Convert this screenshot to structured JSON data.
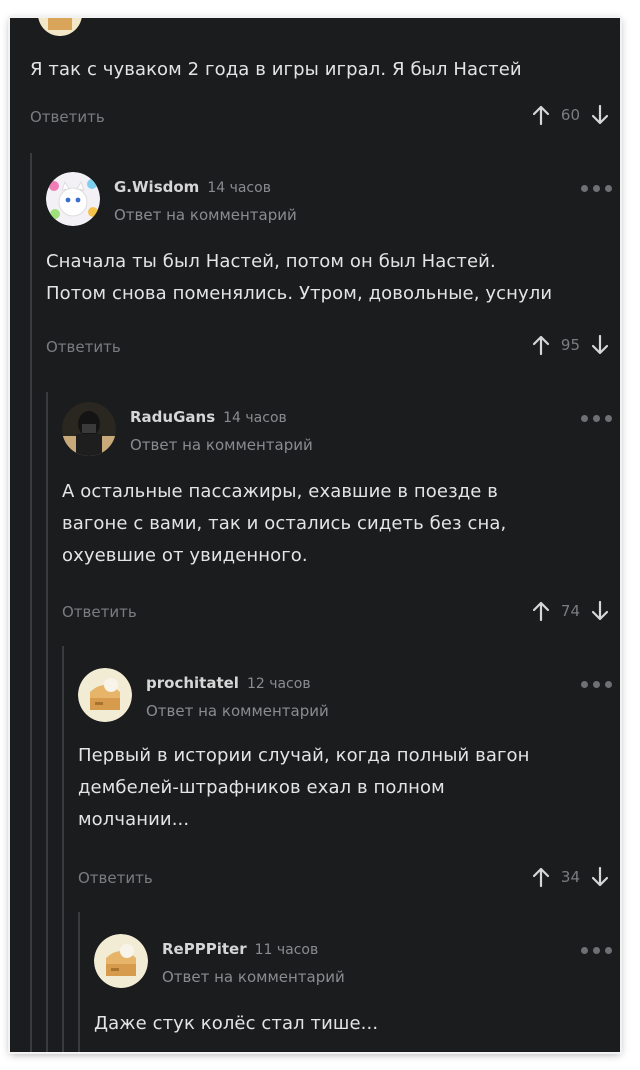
{
  "comments": [
    {
      "text": "Я так с чуваком 2 года в игры играл. Я был Настей",
      "reply_label": "Ответить",
      "votes": "60"
    },
    {
      "author": "G.Wisdom",
      "time": "14 часов",
      "subline": "Ответ на комментарий",
      "lines": [
        "Сначала ты был Настей, потом он был Настей.",
        "Потом снова поменялись. Утром, довольные, уснули"
      ],
      "reply_label": "Ответить",
      "votes": "95"
    },
    {
      "author": "RaduGans",
      "time": "14 часов",
      "subline": "Ответ на комментарий",
      "lines": [
        "А остальные пассажиры, ехавшие в поезде в",
        "вагоне с вами, так и остались сидеть без сна,",
        "охуевшие от увиденного."
      ],
      "reply_label": "Ответить",
      "votes": "74"
    },
    {
      "author": "prochitatel",
      "time": "12 часов",
      "subline": "Ответ на комментарий",
      "lines": [
        "Первый в истории случай, когда полный вагон",
        "дембелей-штрафников ехал в полном",
        "молчании..."
      ],
      "reply_label": "Ответить",
      "votes": "34"
    },
    {
      "author": "RePPPiter",
      "time": "11 часов",
      "subline": "Ответ на комментарий",
      "lines": [
        "Даже стук колёс стал тише..."
      ]
    }
  ],
  "colors": {
    "background": "#1b1c1e",
    "text": "#e4e4e4",
    "muted": "#7b7c80",
    "thread_line": "#3a3b3e"
  }
}
